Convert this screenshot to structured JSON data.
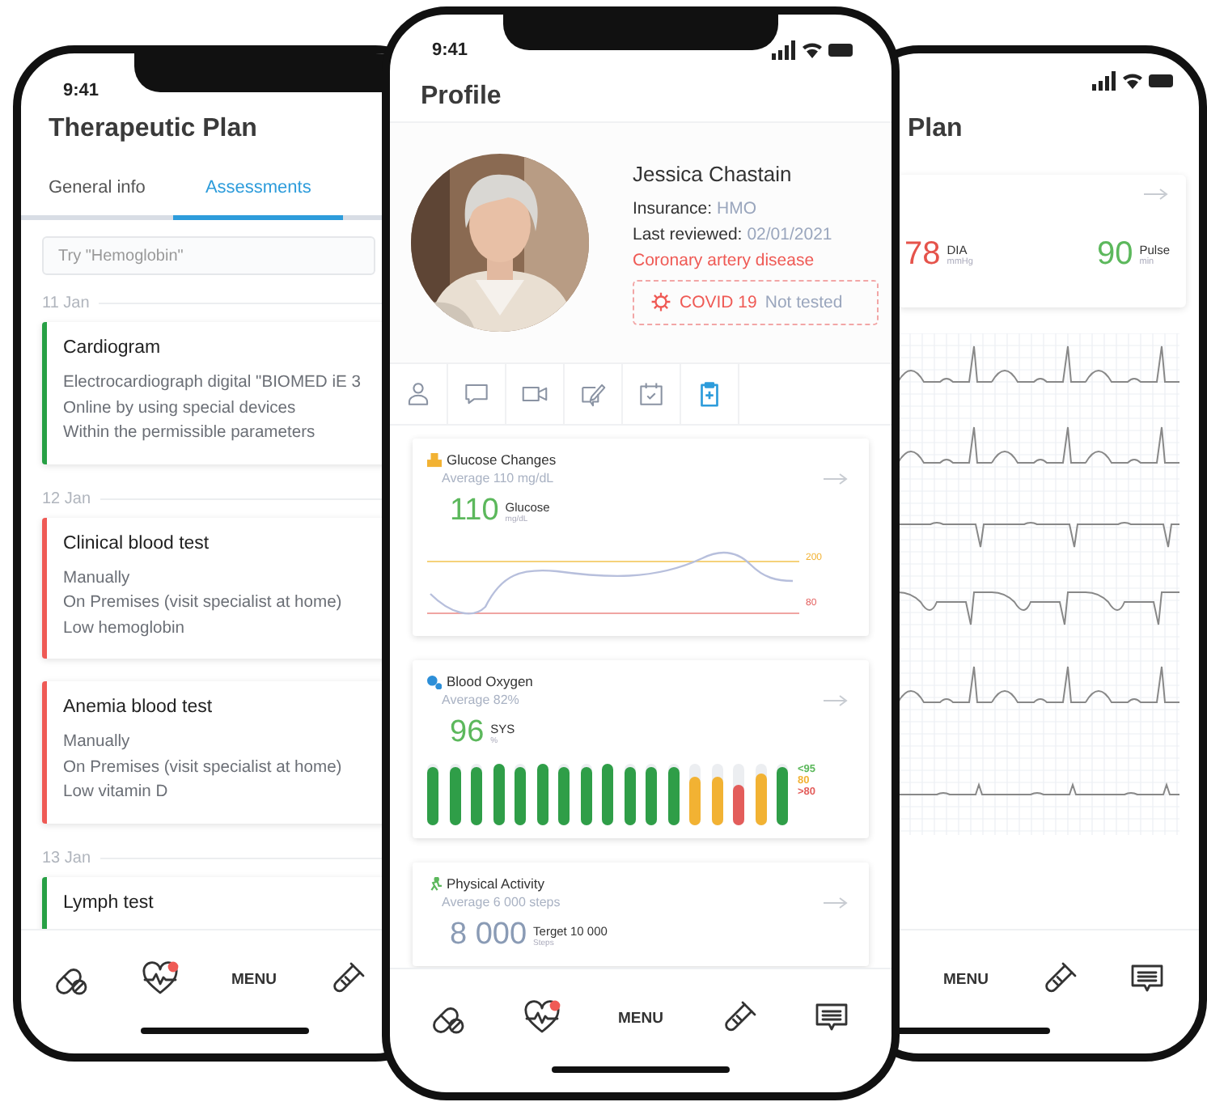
{
  "left_phone": {
    "time": "9:41",
    "title": "Therapeutic Plan",
    "tabs": [
      {
        "label": "General info",
        "selected": false
      },
      {
        "label": "Assessments",
        "selected": true
      }
    ],
    "search": {
      "placeholder": "Try \"Hemoglobin\""
    },
    "groups": [
      {
        "date": "11 Jan",
        "items": [
          {
            "title": "Cardiogram",
            "color": "#27a045",
            "lines": [
              "Electrocardiograph digital \"BIOMED iE 3",
              "Online by using special devices",
              "Within the permissible parameters"
            ]
          }
        ]
      },
      {
        "date": "12 Jan",
        "items": [
          {
            "title": "Clinical blood test",
            "color": "#ef5a55",
            "lines": [
              "Manually",
              "On Premises (visit specialist at home)",
              "Low hemoglobin"
            ]
          },
          {
            "title": "Anemia blood test",
            "color": "#ef5a55",
            "lines": [
              "Manually",
              "On Premises (visit specialist at home)",
              "Low vitamin D"
            ]
          }
        ]
      },
      {
        "date": "13 Jan",
        "items": [
          {
            "title": "Lymph test",
            "color": "#27a045"
          }
        ]
      }
    ],
    "bottom_nav": [
      {
        "kind": "pills"
      },
      {
        "kind": "heart",
        "badge": true
      },
      {
        "kind": "menu",
        "label": "MENU"
      },
      {
        "kind": "tube"
      }
    ]
  },
  "center_phone": {
    "time": "9:41",
    "title": "Profile",
    "profile": {
      "name": "Jessica Chastain",
      "fields": [
        {
          "label": "Insurance:",
          "value": "HMO"
        },
        {
          "label": "Last reviewed:",
          "value": "02/01/2021"
        }
      ],
      "condition": "Coronary artery disease",
      "covid": {
        "label": "COVID 19",
        "status": "Not tested"
      }
    },
    "profile_tabs": [
      {
        "kind": "person",
        "selected": false
      },
      {
        "kind": "chat",
        "selected": false
      },
      {
        "kind": "video",
        "selected": false
      },
      {
        "kind": "notes",
        "selected": false
      },
      {
        "kind": "calendar",
        "selected": false
      },
      {
        "kind": "clipboard",
        "selected": true
      }
    ],
    "cards": [
      {
        "kind": "glucose",
        "title": "Glucose Changes",
        "subtitle": "Average 110 mg/dL",
        "value": "110",
        "color": "#5cb85c",
        "value_label": "Glucose",
        "unit": "mg/dL",
        "threshold_labels": [
          "200",
          "80"
        ]
      },
      {
        "kind": "oxygen",
        "title": "Blood Oxygen",
        "subtitle": "Average 82%",
        "value": "96",
        "color": "#5cb85c",
        "value_label": "SYS",
        "unit": "%",
        "bars": [
          {
            "level": 0.95,
            "color": "#2f9e48"
          },
          {
            "level": 0.95,
            "color": "#2f9e48"
          },
          {
            "level": 0.95,
            "color": "#2f9e48"
          },
          {
            "level": 1,
            "color": "#2f9e48"
          },
          {
            "level": 0.95,
            "color": "#2f9e48"
          },
          {
            "level": 1,
            "color": "#2f9e48"
          },
          {
            "level": 0.95,
            "color": "#2f9e48"
          },
          {
            "level": 0.95,
            "color": "#2f9e48"
          },
          {
            "level": 1,
            "color": "#2f9e48"
          },
          {
            "level": 0.95,
            "color": "#2f9e48"
          },
          {
            "level": 0.95,
            "color": "#2f9e48"
          },
          {
            "level": 0.95,
            "color": "#2f9e48"
          },
          {
            "level": 0.8,
            "color": "#f2b233"
          },
          {
            "level": 0.8,
            "color": "#f2b233"
          },
          {
            "level": 0.65,
            "color": "#e35d5b"
          },
          {
            "level": 0.85,
            "color": "#f2b233"
          },
          {
            "level": 0.95,
            "color": "#2f9e48"
          }
        ],
        "legend": [
          {
            "label": "<95",
            "color": "#5cb85c"
          },
          {
            "label": "80",
            "color": "#f2b233"
          },
          {
            "label": ">80",
            "color": "#e35d5b"
          }
        ]
      },
      {
        "kind": "activity",
        "title": "Physical Activity",
        "subtitle": "Average 6 000 steps",
        "value": "8 000",
        "color": "#8a9bb5",
        "value_label": "Terget 10 000",
        "unit": "Steps"
      }
    ],
    "bottom_nav": [
      {
        "kind": "pills"
      },
      {
        "kind": "heart",
        "badge": true
      },
      {
        "kind": "menu",
        "label": "MENU"
      },
      {
        "kind": "tube"
      },
      {
        "kind": "chat"
      }
    ]
  },
  "right_phone": {
    "title": "Plan",
    "readings": [
      {
        "value": "78",
        "label": "DIA",
        "unit": "mmHg",
        "color": "#e5534b"
      },
      {
        "value": "90",
        "label": "Pulse",
        "unit": "min",
        "color": "#5cb85c"
      }
    ],
    "bottom_nav": [
      {
        "kind": "menu",
        "label": "MENU"
      },
      {
        "kind": "tube"
      },
      {
        "kind": "chat"
      }
    ]
  }
}
